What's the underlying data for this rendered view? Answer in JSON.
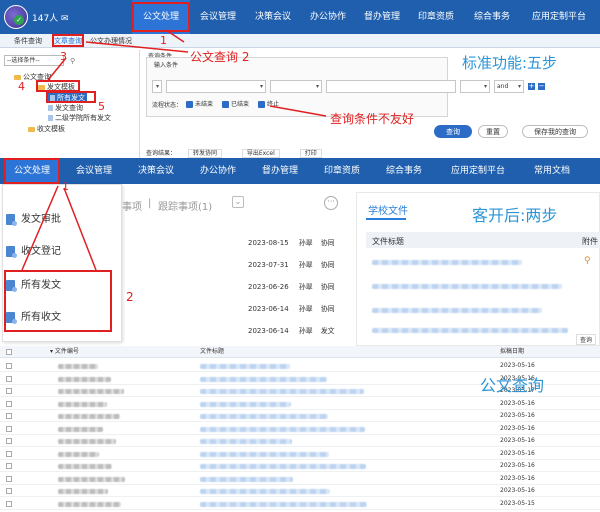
{
  "panel1": {
    "user": {
      "name": "147人"
    },
    "nav": [
      "公文处理",
      "会议管理",
      "决策会议",
      "办公协作",
      "督办管理",
      "印章资质",
      "综合事务",
      "应用定制平台"
    ],
    "subtabs": [
      "条件查询",
      "文章查询",
      "公文办理情况"
    ],
    "tree": {
      "select_placeholder": "--选择条件--",
      "items": [
        "公文查询",
        "发文模板",
        "所有发文",
        "发文查询",
        "二级学院所有发文",
        "收文模板"
      ]
    },
    "conditions": {
      "title": "查询条件",
      "input_label": "输入条件",
      "and_value": "and",
      "status_label": "流程状态：",
      "status_options": [
        "未结束",
        "已结束",
        "终止"
      ]
    },
    "buttons": {
      "query": "查询",
      "reset": "重置",
      "save": "保存我的查询"
    },
    "results_label": "查询结果：",
    "exports": [
      "转发协同",
      "导出Excel",
      "打印"
    ],
    "annotations": {
      "n1": "1",
      "n2": "公文查询 2",
      "n3": "3",
      "n4": "4",
      "n5": "5",
      "unfriendly": "查询条件不友好",
      "standard": "标准功能:五步"
    }
  },
  "panel2": {
    "nav": [
      "公文处理",
      "会议管理",
      "决策会议",
      "办公协作",
      "督办管理",
      "印章资质",
      "综合事务",
      "应用定制平台",
      "常用文档"
    ],
    "menu": [
      "发文审批",
      "收文登记",
      "所有发文",
      "所有收文"
    ],
    "tabs": {
      "pending": "事项",
      "tracking": "跟踪事项(1)"
    },
    "rows": [
      {
        "date": "2023-08-15",
        "user": "孙翠",
        "type": "协同"
      },
      {
        "date": "2023-07-31",
        "user": "孙翠",
        "type": "协同"
      },
      {
        "date": "2023-06-26",
        "user": "孙翠",
        "type": "协同"
      },
      {
        "date": "2023-06-14",
        "user": "孙翠",
        "type": "协同"
      },
      {
        "date": "2023-06-14",
        "user": "孙翠",
        "type": "发文"
      }
    ],
    "school_files": {
      "tab": "学校文件",
      "col_title": "文件标题",
      "col_attach": "附件"
    },
    "annotations": {
      "n1": "1",
      "n2": "2",
      "after": "客开后:两步"
    }
  },
  "panel3": {
    "headers": [
      "文件编号",
      "文件标题",
      "拟稿日期"
    ],
    "dates": [
      "2023-05-16",
      "2023-05-16",
      "2023-05-17",
      "2023-05-16",
      "2023-05-16",
      "2023-05-16",
      "2023-05-16",
      "2023-05-16",
      "2023-05-16",
      "2023-05-16",
      "2023-05-16",
      "2023-05-15"
    ],
    "annotation": "公文查询",
    "query_badge": "查询"
  }
}
